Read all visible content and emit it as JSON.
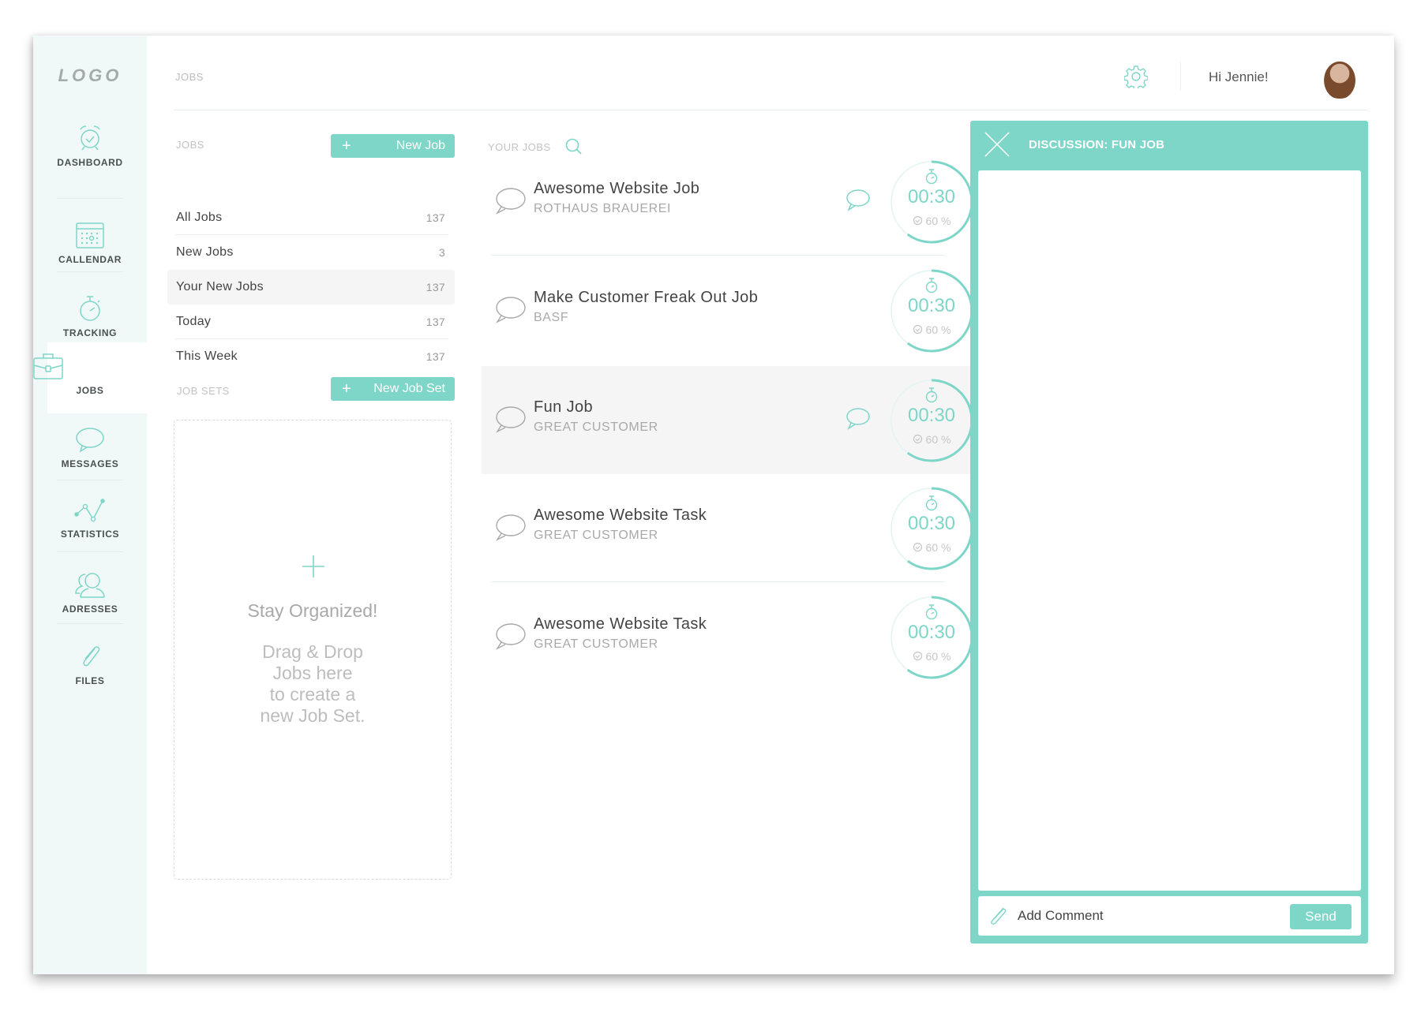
{
  "app": {
    "logo": "LOGO",
    "breadcrumb": "JOBS"
  },
  "header": {
    "greeting": "Hi Jennie!",
    "settings_icon": "gear-icon",
    "avatar_alt": "Jennie avatar"
  },
  "sidebar": {
    "items": [
      {
        "label": "DASHBOARD",
        "icon": "alarm-clock-icon",
        "active": false
      },
      {
        "label": "CALLENDAR",
        "icon": "calendar-icon",
        "active": false
      },
      {
        "label": "TRACKING",
        "icon": "stopwatch-icon",
        "active": false
      },
      {
        "label": "JOBS",
        "icon": "briefcase-icon",
        "active": true
      },
      {
        "label": "MESSAGES",
        "icon": "speech-bubble-icon",
        "active": false
      },
      {
        "label": "STATISTICS",
        "icon": "line-chart-icon",
        "active": false
      },
      {
        "label": "ADRESSES",
        "icon": "users-icon",
        "active": false
      },
      {
        "label": "FILES",
        "icon": "paperclip-icon",
        "active": false
      }
    ]
  },
  "jobs_panel": {
    "label": "JOBS",
    "new_job_label": "New Job",
    "plus": "+",
    "filters": [
      {
        "label": "All Jobs",
        "count": "137"
      },
      {
        "label": "New Jobs",
        "count": "3"
      },
      {
        "label": "Your New Jobs",
        "count": "137",
        "active": true
      },
      {
        "label": "Today",
        "count": "137"
      },
      {
        "label": "This Week",
        "count": "137"
      }
    ]
  },
  "job_sets": {
    "label": "JOB SETS",
    "new_job_set_label": "New Job Set",
    "plus": "+",
    "empty_title": "Stay Organized!",
    "empty_lines": [
      "Drag & Drop",
      "Jobs here",
      "to create a",
      "new Job Set."
    ]
  },
  "your_jobs": {
    "label": "YOUR JOBS",
    "items": [
      {
        "title": "Awesome Website Job",
        "client": "ROTHAUS BRAUEREI",
        "has_messages": true,
        "time": "00:30",
        "progress_label": "60 %",
        "progress": 0.6,
        "active": false
      },
      {
        "title": "Make Customer Freak Out Job",
        "client": "BASF",
        "has_messages": false,
        "time": "00:30",
        "progress_label": "60 %",
        "progress": 0.6,
        "active": false
      },
      {
        "title": "Fun Job",
        "client": "GREAT CUSTOMER",
        "has_messages": true,
        "time": "00:30",
        "progress_label": "60 %",
        "progress": 0.6,
        "active": true
      },
      {
        "title": "Awesome Website Task",
        "client": "GREAT CUSTOMER",
        "has_messages": false,
        "time": "00:30",
        "progress_label": "60 %",
        "progress": 0.6,
        "active": false
      },
      {
        "title": "Awesome Website Task",
        "client": "GREAT CUSTOMER",
        "has_messages": false,
        "time": "00:30",
        "progress_label": "60 %",
        "progress": 0.6,
        "active": false
      }
    ]
  },
  "discussion": {
    "title": "DISCUSSION: FUN JOB",
    "comment_placeholder": "Add Comment",
    "comment_value": "",
    "send_label": "Send"
  },
  "colors": {
    "accent": "#7ed6c8",
    "sidebar_bg": "#f1f9f8",
    "selected_bg": "#f5f5f5"
  }
}
